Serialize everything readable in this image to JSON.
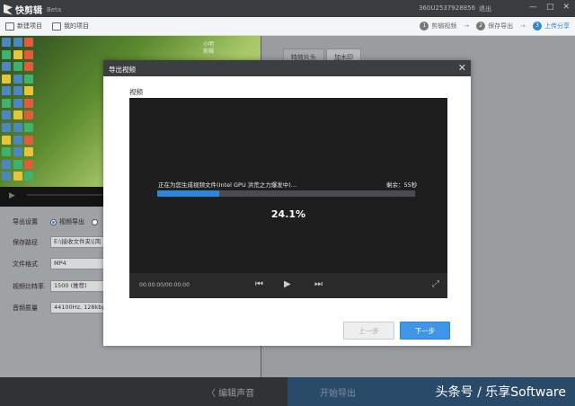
{
  "titlebar": {
    "app_name": "快剪辑",
    "app_badge": "Beta",
    "user_id": "360U2537928856",
    "logout": "退出",
    "minimize_icon": "minimize-icon",
    "maximize_icon": "maximize-icon",
    "close_icon": "close-icon"
  },
  "toolbar": {
    "new_project": "新建项目",
    "my_projects": "我的项目",
    "steps": [
      {
        "num": "1",
        "label": "剪辑视频"
      },
      {
        "num": "2",
        "label": "保存导出"
      },
      {
        "num": "3",
        "label": "上传分享"
      }
    ]
  },
  "preview": {
    "overlay_text": "小明 剪辑"
  },
  "settings": {
    "export_label": "导出设置",
    "export_option": "视频导出",
    "path_label": "保存路径",
    "path_value": "E:\\接收文件夹\\[简",
    "format_label": "文件格式",
    "format_value": "MP4",
    "bitrate_label": "视频比特率",
    "bitrate_value": "1500 (推荐)",
    "audio_label": "音频质量",
    "audio_value": "44100Hz, 128kbp"
  },
  "right_panel": {
    "tabs": [
      "特效片头",
      "加水印"
    ]
  },
  "modal": {
    "title": "导出视频",
    "section": "视频",
    "status": "正在为您生成视频文件(Intel GPU 洪荒之力爆发中)...",
    "remaining": "剩余：55秒",
    "progress": 0.241,
    "percent_text": "24.1%",
    "time": "00:00:00/00:00:00",
    "prev_label": "上一步",
    "next_label": "下一步"
  },
  "bottombar": {
    "edit_audio": "〈 编辑声音",
    "start_export": "开始导出",
    "watermark": "头条号 / 乐享Software"
  },
  "colors": {
    "accent": "#2f86d6",
    "titlebar": "#3a3d40",
    "modal_head": "#3c3f42"
  }
}
